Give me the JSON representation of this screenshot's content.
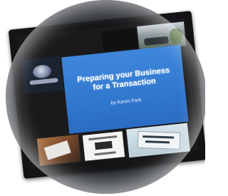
{
  "slide": {
    "title_line1": "Preparing your Business",
    "title_line2": "for a Transaction",
    "byline": "by Kevin Park"
  },
  "colors": {
    "slide_blue": "#3178cf",
    "monitor_bezel": "#141416",
    "background": "#ffffff"
  }
}
